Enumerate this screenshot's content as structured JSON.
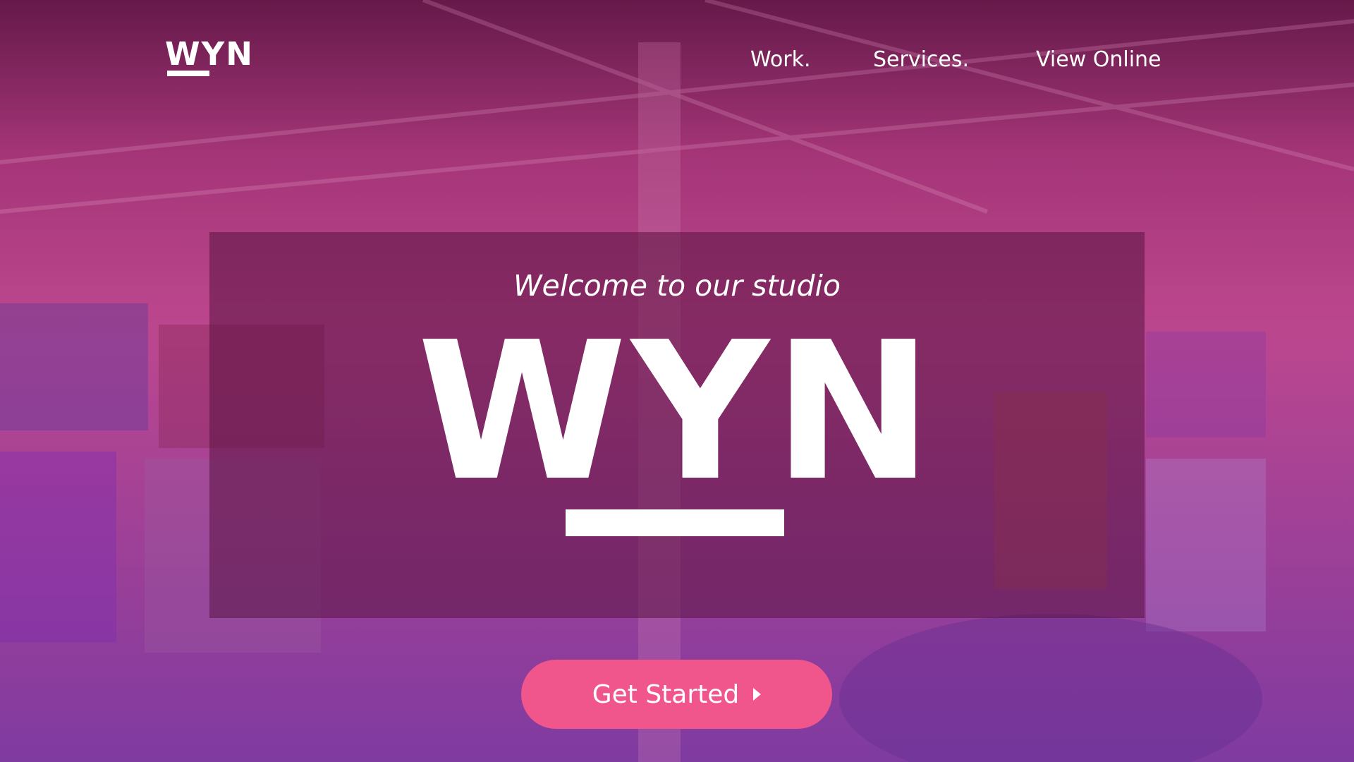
{
  "header": {
    "logo_text": "WYN",
    "nav": {
      "work": "Work.",
      "services": "Services.",
      "view_online": "View Online"
    }
  },
  "hero": {
    "welcome": "Welcome to our studio",
    "logo_text": "WYN"
  },
  "cta": {
    "label": "Get Started",
    "icon": "caret-right-icon"
  },
  "colors": {
    "cta": "#f0558b",
    "overlay": "#5a1441",
    "gradient_top": "#5c1d47",
    "gradient_bottom": "#7e3a9c"
  }
}
